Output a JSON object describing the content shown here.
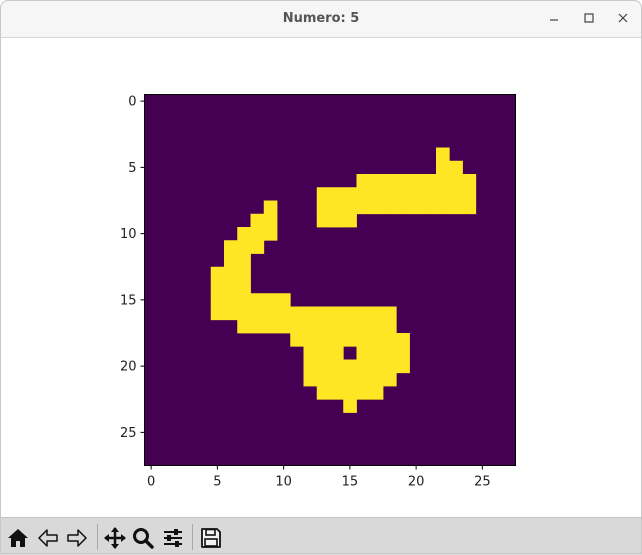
{
  "window": {
    "title": "Numero: 5",
    "controls": [
      "minimize-icon",
      "maximize-icon",
      "close-icon"
    ]
  },
  "toolbar": {
    "buttons": [
      "home-icon",
      "back-arrow-icon",
      "forward-arrow-icon",
      "pan-icon",
      "zoom-icon",
      "configure-subplots-icon",
      "save-icon"
    ]
  },
  "chart_data": {
    "type": "heatmap",
    "title": "",
    "xlabel": "",
    "ylabel": "",
    "rows": 28,
    "cols": 28,
    "xlim": [
      -0.5,
      27.5
    ],
    "ylim": [
      27.5,
      -0.5
    ],
    "x_ticks": [
      "0",
      "5",
      "10",
      "15",
      "20",
      "25"
    ],
    "y_ticks": [
      "0",
      "5",
      "10",
      "15",
      "20",
      "25"
    ],
    "colormap": {
      "low": "#440154",
      "high": "#fde725"
    },
    "on_pixels": [
      [
        4,
        22
      ],
      [
        5,
        22
      ],
      [
        5,
        23
      ],
      [
        6,
        16
      ],
      [
        6,
        17
      ],
      [
        6,
        18
      ],
      [
        6,
        19
      ],
      [
        6,
        20
      ],
      [
        6,
        21
      ],
      [
        6,
        22
      ],
      [
        6,
        23
      ],
      [
        6,
        24
      ],
      [
        7,
        13
      ],
      [
        7,
        14
      ],
      [
        7,
        15
      ],
      [
        7,
        16
      ],
      [
        7,
        17
      ],
      [
        7,
        18
      ],
      [
        7,
        19
      ],
      [
        7,
        20
      ],
      [
        7,
        21
      ],
      [
        7,
        22
      ],
      [
        7,
        23
      ],
      [
        7,
        24
      ],
      [
        8,
        9
      ],
      [
        8,
        13
      ],
      [
        8,
        14
      ],
      [
        8,
        15
      ],
      [
        8,
        16
      ],
      [
        8,
        17
      ],
      [
        8,
        18
      ],
      [
        8,
        19
      ],
      [
        8,
        20
      ],
      [
        8,
        21
      ],
      [
        8,
        22
      ],
      [
        8,
        23
      ],
      [
        8,
        24
      ],
      [
        9,
        8
      ],
      [
        9,
        9
      ],
      [
        9,
        13
      ],
      [
        9,
        14
      ],
      [
        9,
        15
      ],
      [
        10,
        7
      ],
      [
        10,
        8
      ],
      [
        10,
        9
      ],
      [
        11,
        6
      ],
      [
        11,
        7
      ],
      [
        11,
        8
      ],
      [
        12,
        6
      ],
      [
        12,
        7
      ],
      [
        13,
        5
      ],
      [
        13,
        6
      ],
      [
        13,
        7
      ],
      [
        14,
        5
      ],
      [
        14,
        6
      ],
      [
        14,
        7
      ],
      [
        15,
        5
      ],
      [
        15,
        6
      ],
      [
        15,
        7
      ],
      [
        15,
        8
      ],
      [
        15,
        9
      ],
      [
        15,
        10
      ],
      [
        16,
        5
      ],
      [
        16,
        6
      ],
      [
        16,
        7
      ],
      [
        16,
        8
      ],
      [
        16,
        9
      ],
      [
        16,
        10
      ],
      [
        16,
        11
      ],
      [
        16,
        12
      ],
      [
        16,
        13
      ],
      [
        16,
        14
      ],
      [
        16,
        15
      ],
      [
        16,
        16
      ],
      [
        16,
        17
      ],
      [
        16,
        18
      ],
      [
        17,
        7
      ],
      [
        17,
        8
      ],
      [
        17,
        9
      ],
      [
        17,
        10
      ],
      [
        17,
        11
      ],
      [
        17,
        12
      ],
      [
        17,
        13
      ],
      [
        17,
        14
      ],
      [
        17,
        15
      ],
      [
        17,
        16
      ],
      [
        17,
        17
      ],
      [
        17,
        18
      ],
      [
        18,
        11
      ],
      [
        18,
        12
      ],
      [
        18,
        13
      ],
      [
        18,
        14
      ],
      [
        18,
        15
      ],
      [
        18,
        16
      ],
      [
        18,
        17
      ],
      [
        18,
        18
      ],
      [
        18,
        19
      ],
      [
        19,
        12
      ],
      [
        19,
        13
      ],
      [
        19,
        14
      ],
      [
        19,
        16
      ],
      [
        19,
        17
      ],
      [
        19,
        18
      ],
      [
        19,
        19
      ],
      [
        20,
        12
      ],
      [
        20,
        13
      ],
      [
        20,
        14
      ],
      [
        20,
        15
      ],
      [
        20,
        16
      ],
      [
        20,
        17
      ],
      [
        20,
        18
      ],
      [
        20,
        19
      ],
      [
        21,
        12
      ],
      [
        21,
        13
      ],
      [
        21,
        14
      ],
      [
        21,
        15
      ],
      [
        21,
        16
      ],
      [
        21,
        17
      ],
      [
        21,
        18
      ],
      [
        22,
        13
      ],
      [
        22,
        14
      ],
      [
        22,
        15
      ],
      [
        22,
        16
      ],
      [
        22,
        17
      ],
      [
        23,
        15
      ]
    ]
  }
}
